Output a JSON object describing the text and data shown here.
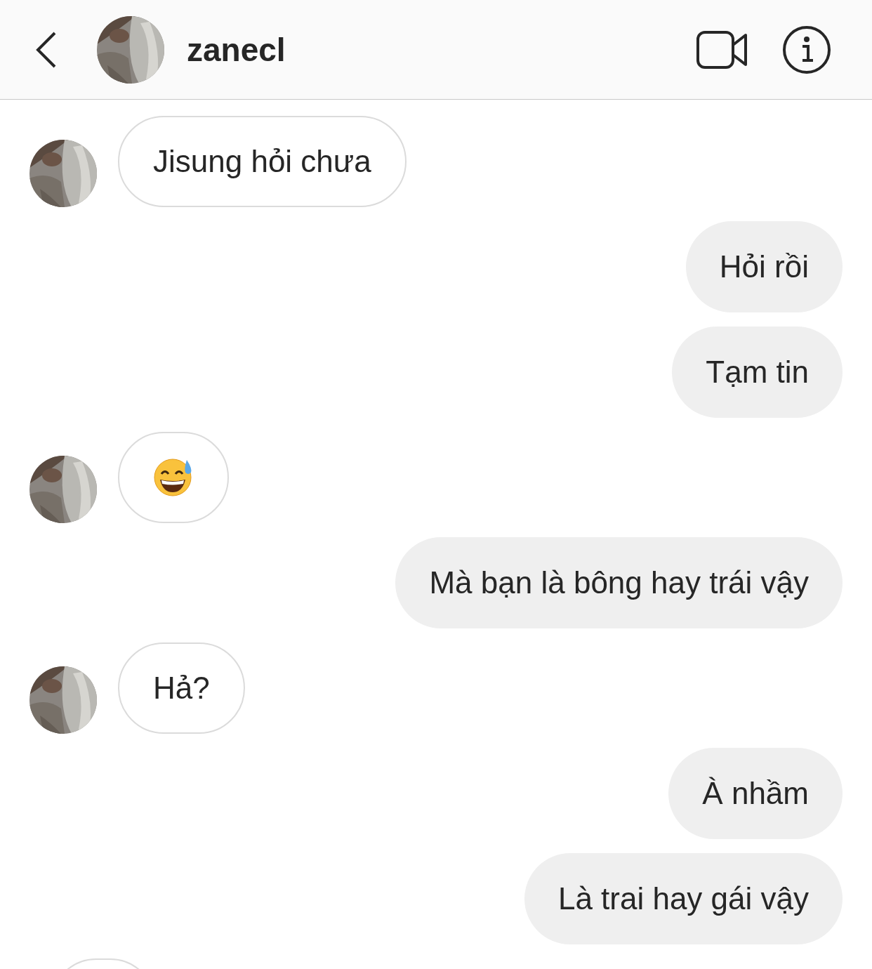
{
  "header": {
    "username": "zanecl"
  },
  "messages": [
    {
      "outgoing": false,
      "kind": "text",
      "text": "Jisung hỏi chưa"
    },
    {
      "outgoing": true,
      "kind": "text",
      "text": "Hỏi rồi"
    },
    {
      "outgoing": true,
      "kind": "text",
      "text": "Tạm tin"
    },
    {
      "outgoing": false,
      "kind": "emoji"
    },
    {
      "outgoing": true,
      "kind": "text",
      "text": "Mà bạn là bông hay trái vậy"
    },
    {
      "outgoing": false,
      "kind": "text",
      "text": "Hả?"
    },
    {
      "outgoing": true,
      "kind": "text",
      "text": "À nhầm"
    },
    {
      "outgoing": true,
      "kind": "text",
      "text": "Là trai hay gái vậy"
    },
    {
      "outgoing": false,
      "kind": "partial"
    }
  ]
}
